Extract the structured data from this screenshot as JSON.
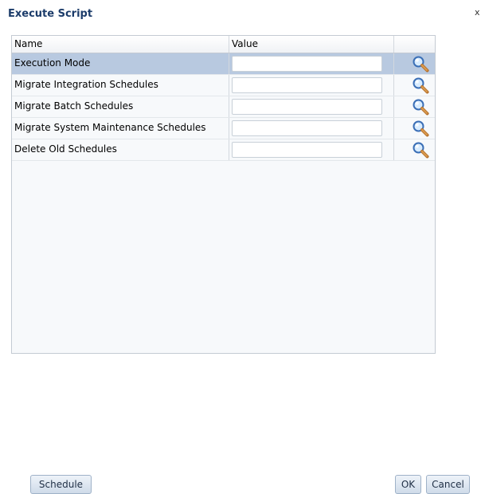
{
  "dialog": {
    "title": "Execute Script",
    "close_label": "x"
  },
  "grid": {
    "columns": {
      "name": "Name",
      "value": "Value"
    },
    "rows": [
      {
        "name": "Execution Mode",
        "value": "",
        "selected": true
      },
      {
        "name": "Migrate Integration Schedules",
        "value": "",
        "selected": false
      },
      {
        "name": "Migrate Batch Schedules",
        "value": "",
        "selected": false
      },
      {
        "name": "Migrate System Maintenance Schedules",
        "value": "",
        "selected": false
      },
      {
        "name": "Delete Old Schedules",
        "value": "",
        "selected": false
      }
    ],
    "row_action_icon": "search-icon"
  },
  "footer": {
    "schedule_label": "Schedule",
    "ok_label": "OK",
    "cancel_label": "Cancel"
  },
  "colors": {
    "title": "#1c3c6a",
    "selected_row": "#b8c9e0",
    "grid_border": "#c4cbd3"
  }
}
